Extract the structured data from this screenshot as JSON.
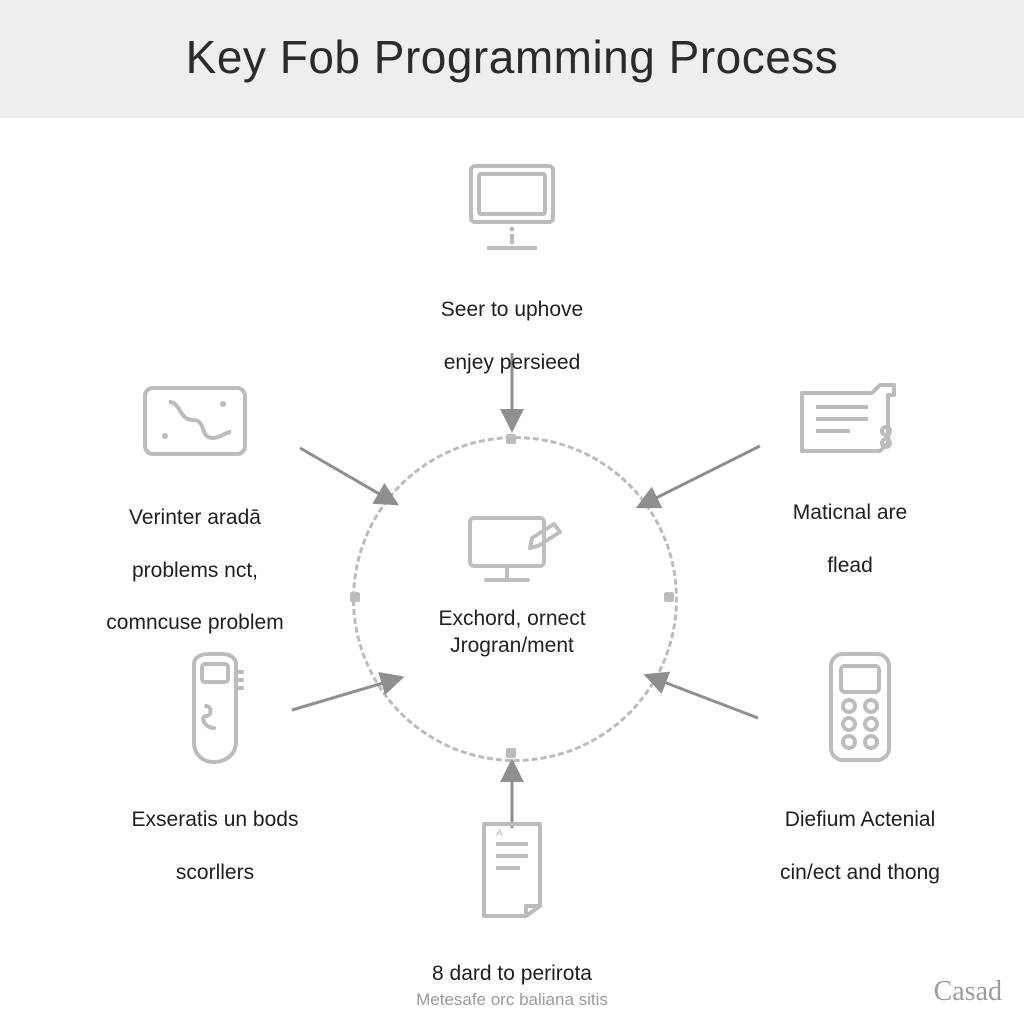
{
  "title": "Key Fob Programming Process",
  "center": {
    "line1": "Exchord, ornect",
    "line2": "Jrogran/ment"
  },
  "nodes": {
    "top": {
      "line1": "Seer to uphove",
      "line2": "enjey persieed"
    },
    "left_upper": {
      "line1": "Verinter aradā",
      "line2": "problems nct,",
      "line3": "comncuse problem"
    },
    "right_upper": {
      "line1": "Maticnal are",
      "line2": "flead"
    },
    "left_lower": {
      "line1": "Exseratis un bods",
      "line2": "scorllers"
    },
    "right_lower": {
      "line1": "Diefium Actenial",
      "line2": "cin/ect and thong"
    },
    "bottom": {
      "line1": "8 dard to perirota",
      "sub": "Metesafe orc baliana sitis"
    }
  },
  "brand": "Casad",
  "icons": {
    "top": "monitor-icon",
    "center": "monitor-pencil-icon",
    "left_upper": "map-tablet-icon",
    "right_upper": "document-folder-icon",
    "left_lower": "key-fob-icon",
    "right_lower": "scanner-device-icon",
    "bottom": "paper-note-icon"
  }
}
